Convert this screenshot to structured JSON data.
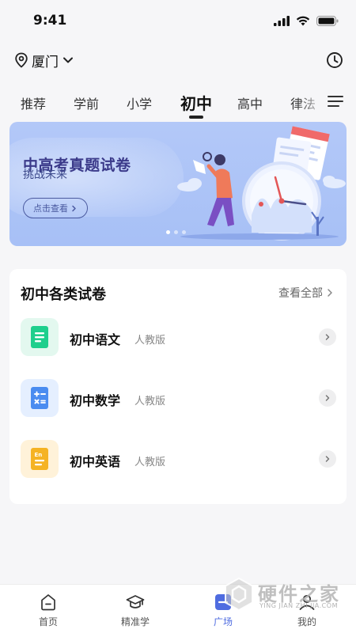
{
  "status_bar": {
    "time": "9:41"
  },
  "location": {
    "city": "厦门"
  },
  "tabs": [
    {
      "label": "推荐"
    },
    {
      "label": "学前"
    },
    {
      "label": "小学"
    },
    {
      "label": "初中",
      "active": true
    },
    {
      "label": "高中"
    },
    {
      "label": "律法"
    }
  ],
  "banner": {
    "title": "中高考真题试卷",
    "subtitle": "挑战未来",
    "button_label": "点击查看",
    "slide_count": 3,
    "active_slide": 1
  },
  "section": {
    "title": "初中各类试卷",
    "view_all_label": "查看全部",
    "items": [
      {
        "name": "初中语文",
        "edition": "人教版",
        "icon": "chinese-book-icon",
        "color": "#1fcf8d",
        "bg": "#e3f8ef"
      },
      {
        "name": "初中数学",
        "edition": "人教版",
        "icon": "math-book-icon",
        "color": "#4a8cf0",
        "bg": "#e5efff"
      },
      {
        "name": "初中英语",
        "edition": "人教版",
        "icon": "english-book-icon",
        "color": "#f5b324",
        "bg": "#fff2d9"
      }
    ]
  },
  "bottom_nav": [
    {
      "label": "首页",
      "icon": "home-icon"
    },
    {
      "label": "精准学",
      "icon": "graduation-cap-icon"
    },
    {
      "label": "广场",
      "icon": "plaza-icon",
      "active": true
    },
    {
      "label": "我的",
      "icon": "profile-icon"
    }
  ],
  "watermark": {
    "text": "硬件之家",
    "sub": "YING JIAN ZHI JIA.COM"
  },
  "colors": {
    "accent": "#4f6ce0",
    "banner_bg": "#b3c8f8",
    "page_bg": "#f6f6f8"
  }
}
